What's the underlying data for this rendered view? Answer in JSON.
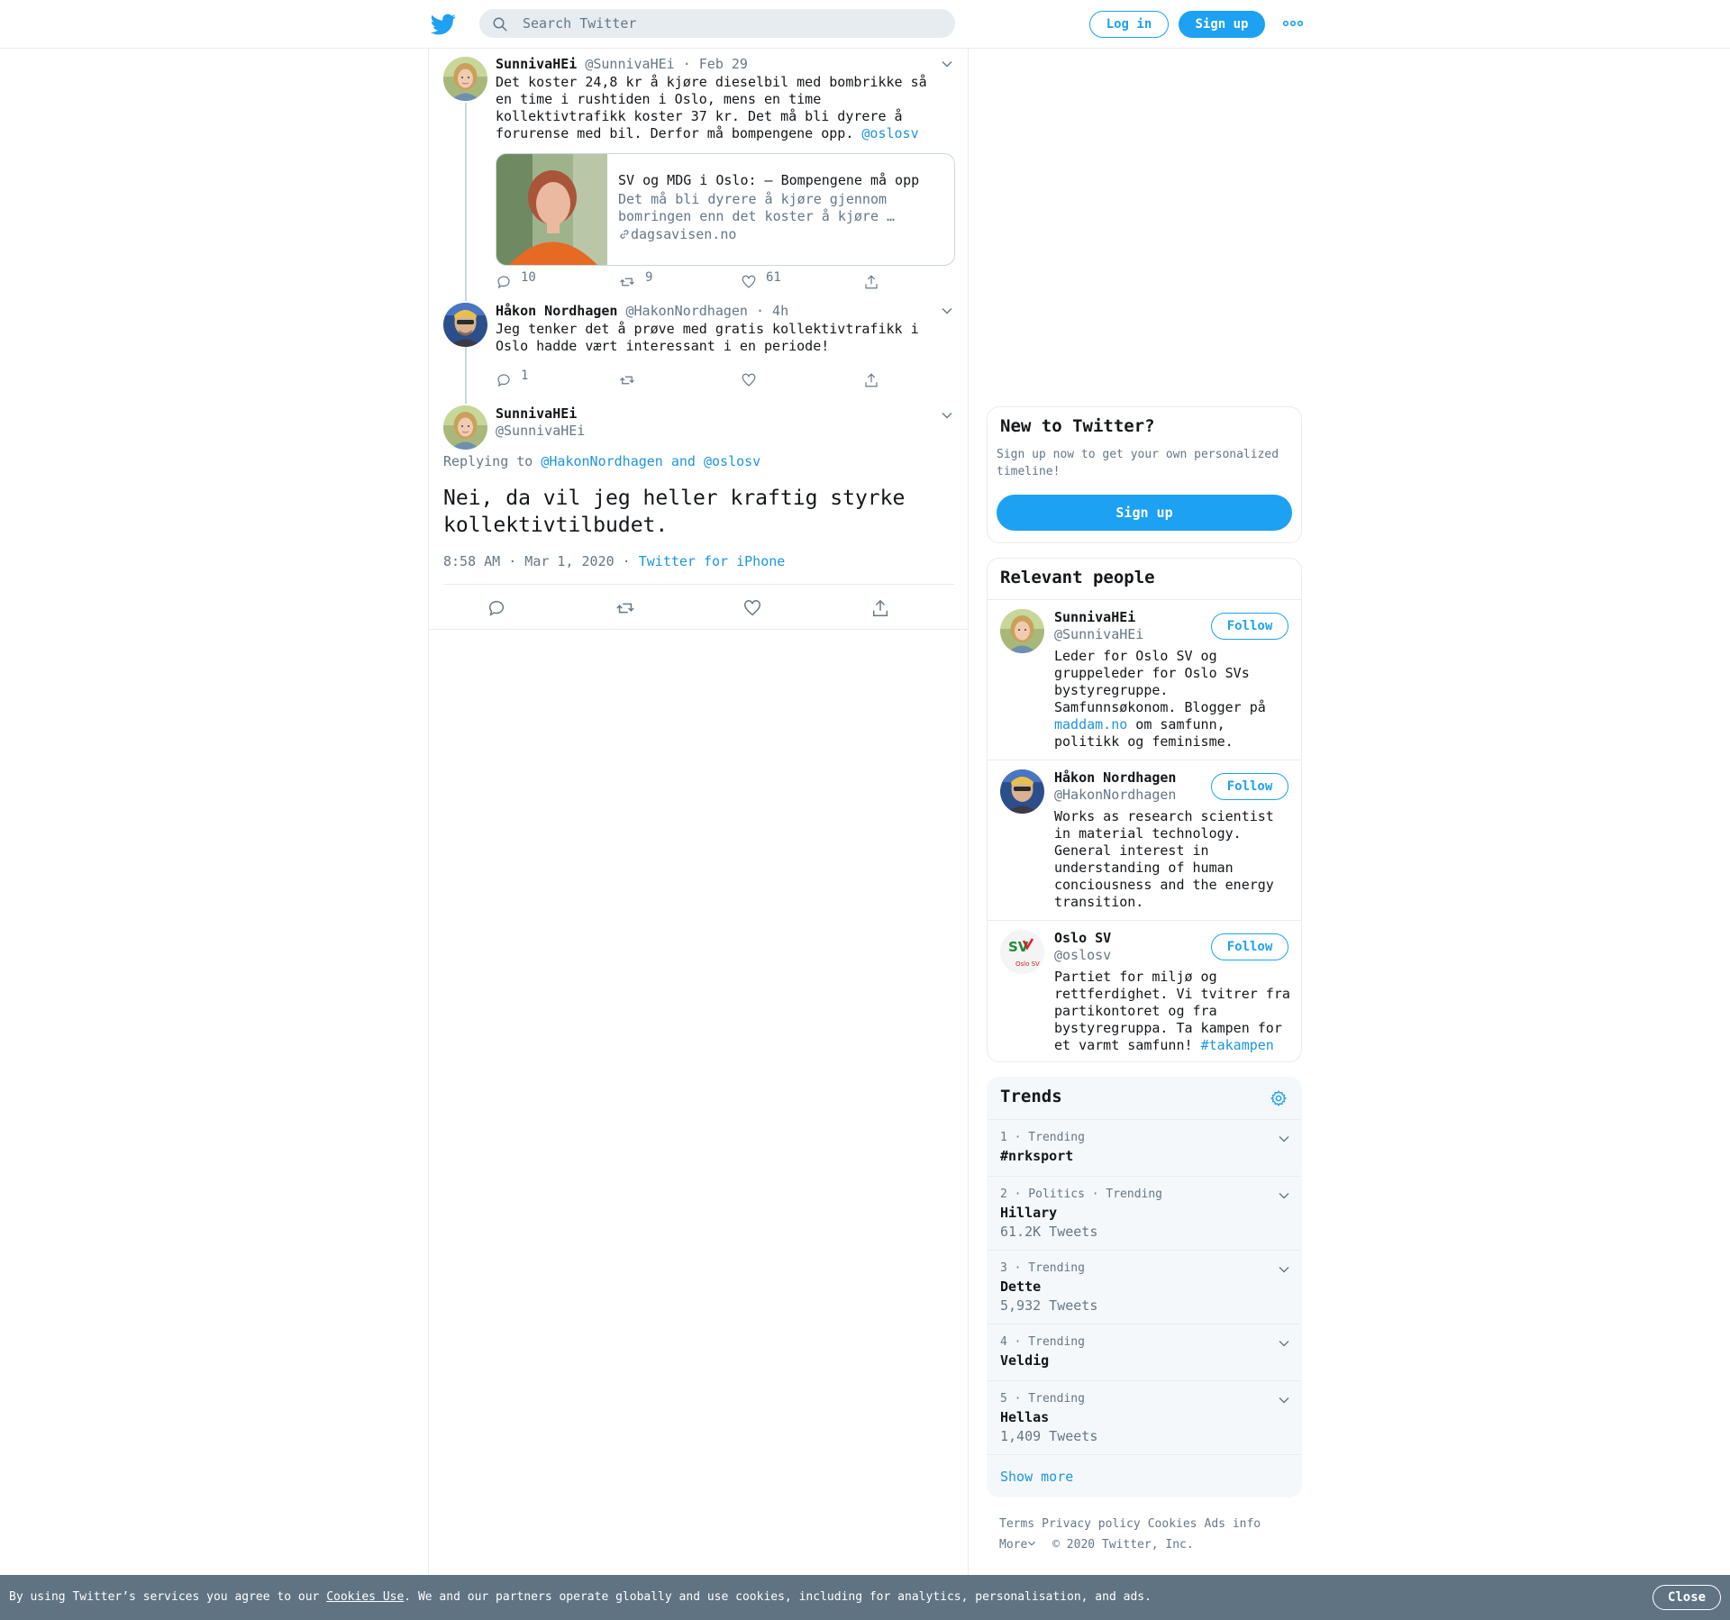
{
  "header": {
    "search_placeholder": "Search Twitter",
    "login_label": "Log in",
    "signup_label": "Sign up"
  },
  "thread": {
    "tweet1": {
      "name": "SunnivaHEi",
      "handle": "@SunnivaHEi",
      "date": "· Feb 29",
      "text": "Det koster 24,8 kr å kjøre dieselbil med bombrikke så en time i rushtiden i Oslo, mens en time kollektivtrafikk koster 37 kr. Det må bli dyrere å forurense med bil. Derfor må bompengene opp. ",
      "mention": "@oslosv",
      "card": {
        "title": "SV og MDG i Oslo: – Bompengene må opp",
        "description": "Det må bli dyrere å kjøre gjennom bomringen enn det koster å kjøre …",
        "domain": "dagsavisen.no"
      },
      "replies": "10",
      "retweets": "9",
      "likes": "61"
    },
    "tweet2": {
      "name": "Håkon Nordhagen",
      "handle": "@HakonNordhagen",
      "date": "· 4h",
      "text": "Jeg tenker det å prøve med gratis kollektivtrafikk i Oslo hadde vært interessant i en periode!",
      "replies": "1"
    },
    "focus": {
      "name": "SunnivaHEi",
      "handle": "@SunnivaHEi",
      "replying_prefix": "Replying to ",
      "replying_to": "@HakonNordhagen and @oslosv",
      "text": "Nei, da vil jeg heller kraftig styrke kollektivtilbudet.",
      "timestamp": "8:58 AM · Mar 1, 2020 ·",
      "source": "Twitter for iPhone"
    }
  },
  "sidebar": {
    "new_to_twitter": {
      "title": "New to Twitter?",
      "text": "Sign up now to get your own personalized timeline!",
      "signup_label": "Sign up"
    },
    "relevant_people": {
      "title": "Relevant people",
      "follow_label": "Follow",
      "people": [
        {
          "name": "SunnivaHEi",
          "handle": "@SunnivaHEi",
          "bio_a": "Leder for Oslo SV og gruppeleder for Oslo SVs bystyregruppe. Samfunnsøkonom. Blogger på ",
          "bio_link": "maddam.no",
          "bio_b": " om samfunn, politikk og feminisme."
        },
        {
          "name": "Håkon Nordhagen",
          "handle": "@HakonNordhagen",
          "bio_a": "Works as research scientist in material technology. General interest in understanding of human conciousness and the energy transition."
        },
        {
          "name": "Oslo SV",
          "handle": "@oslosv",
          "bio_a": "Partiet for miljø og rettferdighet. Vi tvitrer fra partikontoret og fra bystyregruppa. Ta kampen for et varmt samfunn! ",
          "bio_link": "#takampen",
          "logo_text": "SV",
          "logo_sub": "Oslo SV"
        }
      ]
    },
    "trends": {
      "title": "Trends",
      "items": [
        {
          "meta": "1 · Trending",
          "name": "#nrksport",
          "count": ""
        },
        {
          "meta": "2 · Politics · Trending",
          "name": "Hillary",
          "count": "61.2K Tweets"
        },
        {
          "meta": "3 · Trending",
          "name": "Dette",
          "count": "5,932 Tweets"
        },
        {
          "meta": "4 · Trending",
          "name": "Veldig",
          "count": ""
        },
        {
          "meta": "5 · Trending",
          "name": "Hellas",
          "count": "1,409 Tweets"
        }
      ],
      "show_more": "Show more"
    },
    "footer": {
      "terms": "Terms",
      "privacy": "Privacy policy",
      "cookies": "Cookies",
      "ads": "Ads info",
      "more": "More",
      "copyright": "© 2020 Twitter, Inc."
    }
  },
  "cookie_banner": {
    "text_a": "By using Twitter’s services you agree to our ",
    "link": "Cookies Use",
    "text_b": ". We and our partners operate globally and use cookies, including for analytics, personalisation, and ads.",
    "close_label": "Close"
  },
  "colors": {
    "accent": "#1da1f2",
    "link": "#1b95e0",
    "secondary_text": "#657786",
    "cookie_banner": "#5f7383"
  }
}
